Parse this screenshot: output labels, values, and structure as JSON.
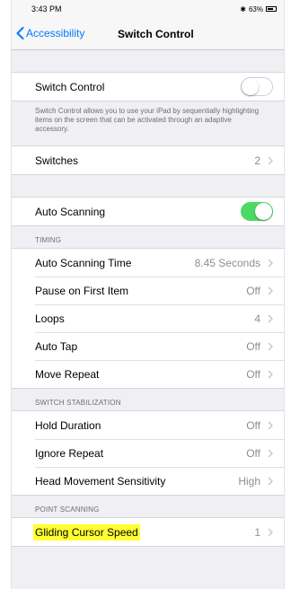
{
  "status_bar": {
    "time": "3:43 PM",
    "battery": "63%"
  },
  "nav": {
    "back_label": "Accessibility",
    "title": "Switch Control"
  },
  "switch_control": {
    "label": "Switch Control",
    "toggle_on": false,
    "footer": "Switch Control allows you to use your iPad by sequentially highlighting items on the screen that can be activated through an adaptive accessory."
  },
  "switches": {
    "label": "Switches",
    "value": "2"
  },
  "auto_scanning": {
    "label": "Auto Scanning",
    "toggle_on": true
  },
  "timing": {
    "header": "TIMING",
    "items": [
      {
        "label": "Auto Scanning Time",
        "value": "8.45 Seconds"
      },
      {
        "label": "Pause on First Item",
        "value": "Off"
      },
      {
        "label": "Loops",
        "value": "4"
      },
      {
        "label": "Auto Tap",
        "value": "Off"
      },
      {
        "label": "Move Repeat",
        "value": "Off"
      }
    ]
  },
  "switch_stabilization": {
    "header": "SWITCH STABILIZATION",
    "items": [
      {
        "label": "Hold Duration",
        "value": "Off"
      },
      {
        "label": "Ignore Repeat",
        "value": "Off"
      },
      {
        "label": "Head Movement Sensitivity",
        "value": "High"
      }
    ]
  },
  "point_scanning": {
    "header": "POINT SCANNING",
    "items": [
      {
        "label": "Gliding Cursor Speed",
        "value": "1"
      }
    ]
  },
  "colors": {
    "accent": "#007aff",
    "toggle_on": "#4cd964",
    "highlight": "#ffff33",
    "background": "#efeff4"
  }
}
